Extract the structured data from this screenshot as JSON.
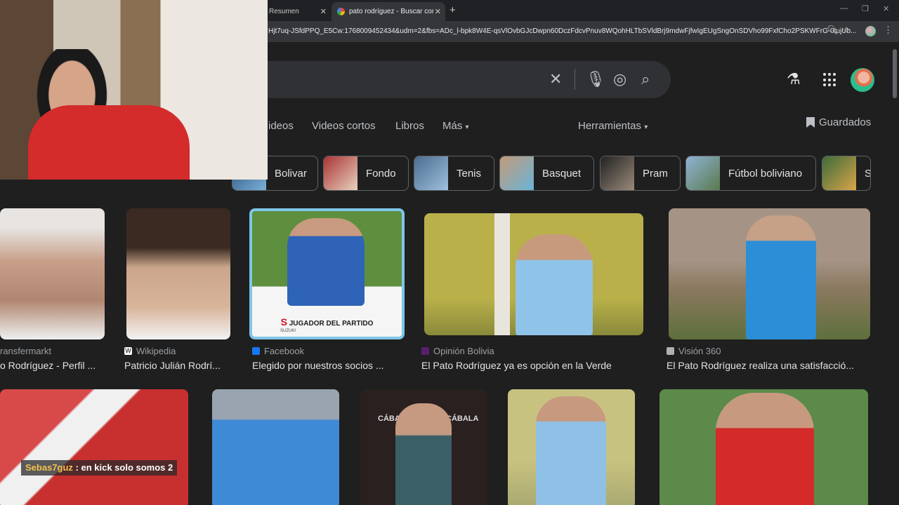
{
  "browser": {
    "tabs": [
      {
        "title": "Resumen",
        "active": false
      },
      {
        "title": "pato rodríguez - Buscar con Google",
        "active": true
      }
    ],
    "url": "Hjt7uq-JSfdPPQ_E5Cw:1768009452434&udm=2&fbs=ADc_l-bpk8W4E-qsVlOvbGJcDwpn60DczFdcvPnuv8WQohHLTbSVldBrj9mdwFjfwIgEUgSngOnSDVho99FxfCho2PSKWFrG-0tujUb..."
  },
  "nav": {
    "tabs": [
      "ideos",
      "Videos cortos",
      "Libros",
      "Más"
    ],
    "tools": "Herramientas",
    "saved": "Guardados"
  },
  "chips": [
    "Bolivar",
    "Fondo",
    "Tenis",
    "Basquet",
    "Pram",
    "Fútbol boliviano",
    "S"
  ],
  "results_row1": [
    {
      "source": "ransfermarkt",
      "caption": "o Rodríguez - Perfil ..."
    },
    {
      "source": "Wikipedia",
      "caption": "Patricio Julián Rodrí..."
    },
    {
      "source": "Facebook",
      "caption": "Elegido por nuestros socios ..."
    },
    {
      "source": "Opinión Bolivia",
      "caption": "El Pato Rodríguez ya es opción en la Verde"
    },
    {
      "source": "Visión 360",
      "caption": "El Pato Rodríguez realiza una satisfacció..."
    }
  ],
  "image_text": {
    "award_banner": "JUGADOR DEL PARTIDO",
    "sponsor": "SUZUKI",
    "cabala": "CÁBALA"
  },
  "chat": {
    "user": "Sebas7guz",
    "message": " : en kick solo somos 2"
  },
  "colors": {
    "page_bg": "#1f1f1f",
    "chip_border": "#5f6368",
    "chat_user": "#f2c14e"
  }
}
